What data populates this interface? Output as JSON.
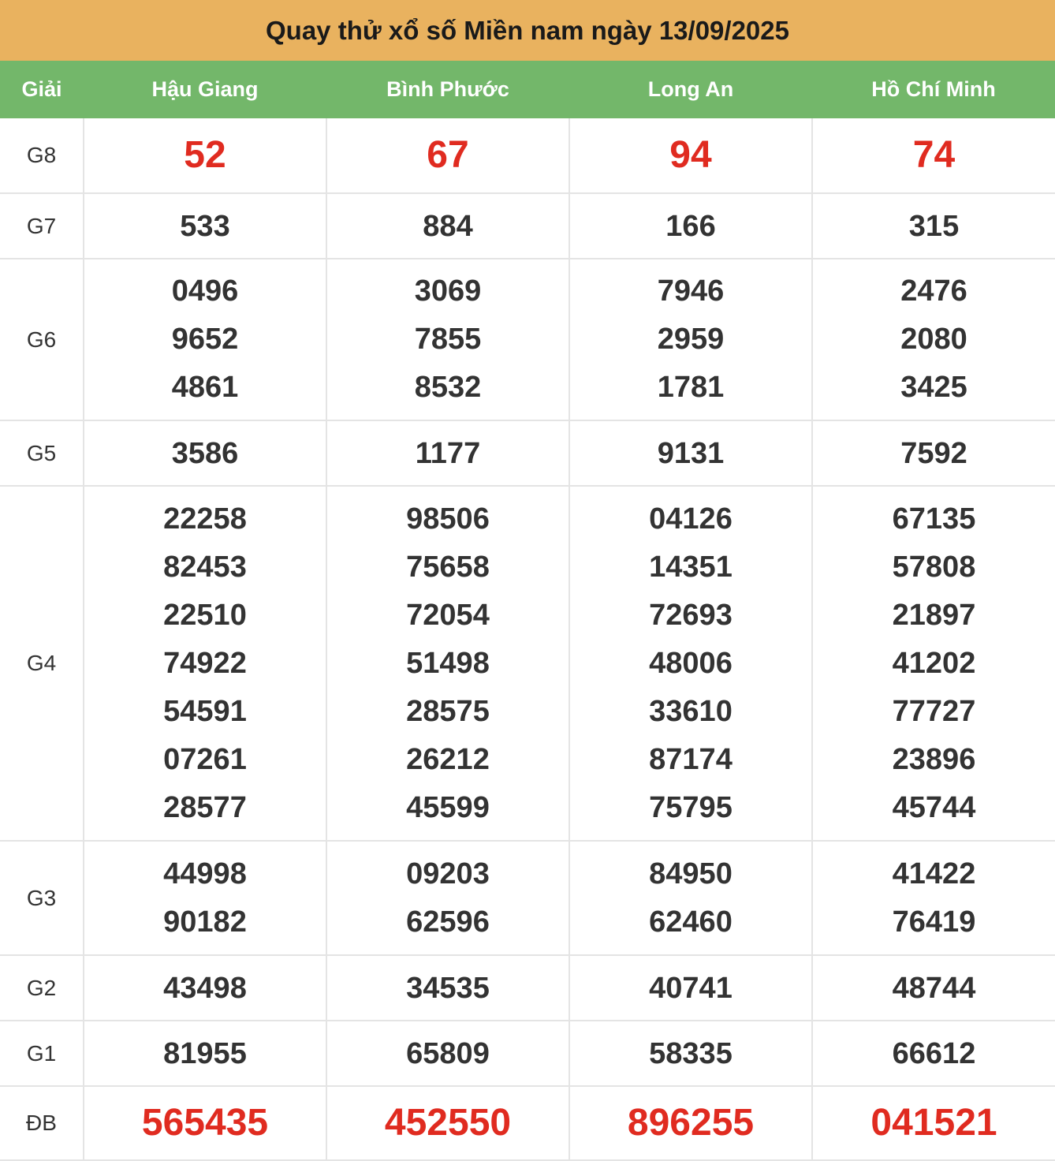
{
  "title": "Quay thử xổ số Miền nam ngày 13/09/2025",
  "header": {
    "prize_label": "Giải",
    "provinces": [
      "Hậu Giang",
      "Bình Phước",
      "Long An",
      "Hồ Chí Minh"
    ]
  },
  "rows": [
    {
      "label": "G8",
      "values": [
        [
          "52"
        ],
        [
          "67"
        ],
        [
          "94"
        ],
        [
          "74"
        ]
      ]
    },
    {
      "label": "G7",
      "values": [
        [
          "533"
        ],
        [
          "884"
        ],
        [
          "166"
        ],
        [
          "315"
        ]
      ]
    },
    {
      "label": "G6",
      "values": [
        [
          "0496",
          "9652",
          "4861"
        ],
        [
          "3069",
          "7855",
          "8532"
        ],
        [
          "7946",
          "2959",
          "1781"
        ],
        [
          "2476",
          "2080",
          "3425"
        ]
      ]
    },
    {
      "label": "G5",
      "values": [
        [
          "3586"
        ],
        [
          "1177"
        ],
        [
          "9131"
        ],
        [
          "7592"
        ]
      ]
    },
    {
      "label": "G4",
      "values": [
        [
          "22258",
          "82453",
          "22510",
          "74922",
          "54591",
          "07261",
          "28577"
        ],
        [
          "98506",
          "75658",
          "72054",
          "51498",
          "28575",
          "26212",
          "45599"
        ],
        [
          "04126",
          "14351",
          "72693",
          "48006",
          "33610",
          "87174",
          "75795"
        ],
        [
          "67135",
          "57808",
          "21897",
          "41202",
          "77727",
          "23896",
          "45744"
        ]
      ]
    },
    {
      "label": "G3",
      "values": [
        [
          "44998",
          "90182"
        ],
        [
          "09203",
          "62596"
        ],
        [
          "84950",
          "62460"
        ],
        [
          "41422",
          "76419"
        ]
      ]
    },
    {
      "label": "G2",
      "values": [
        [
          "43498"
        ],
        [
          "34535"
        ],
        [
          "40741"
        ],
        [
          "48744"
        ]
      ]
    },
    {
      "label": "G1",
      "values": [
        [
          "81955"
        ],
        [
          "65809"
        ],
        [
          "58335"
        ],
        [
          "66612"
        ]
      ]
    },
    {
      "label": "ĐB",
      "values": [
        [
          "565435"
        ],
        [
          "452550"
        ],
        [
          "896255"
        ],
        [
          "041521"
        ]
      ]
    }
  ],
  "colors": {
    "title_bg": "#e9b25f",
    "header_bg": "#73b76a",
    "highlight": "#e02b20",
    "text": "#333333",
    "border": "#e4e4e4"
  }
}
